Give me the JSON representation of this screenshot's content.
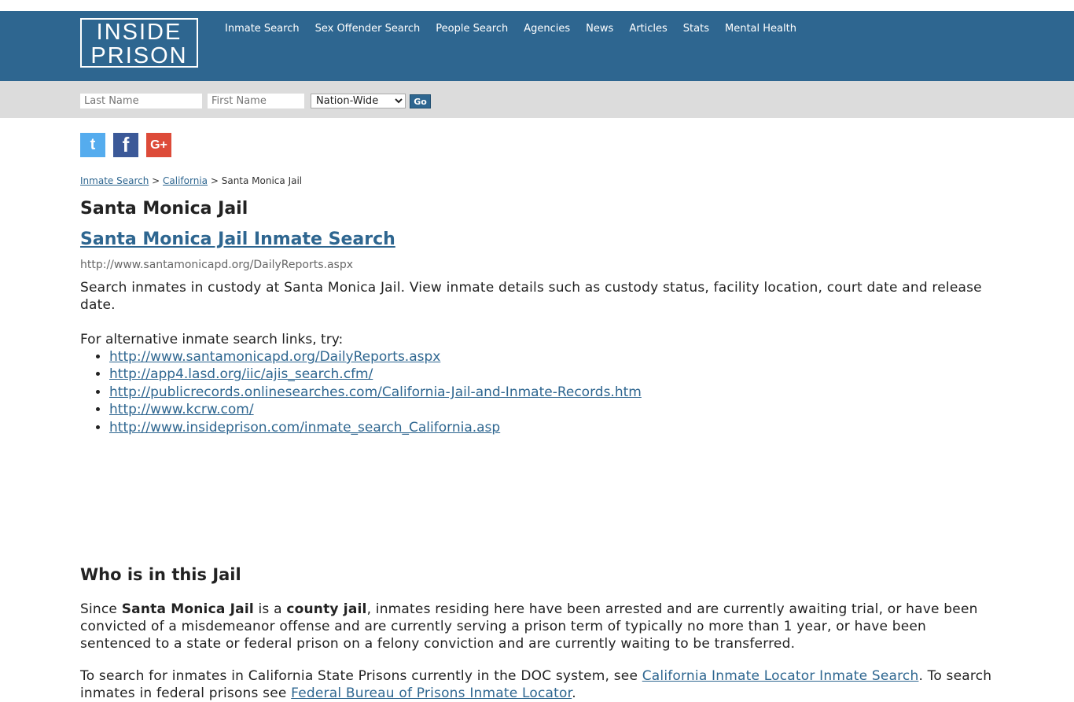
{
  "header": {
    "logo_line1": "INSIDE",
    "logo_line2": "PRISON",
    "nav": [
      "Inmate Search",
      "Sex Offender Search",
      "People Search",
      "Agencies",
      "News",
      "Articles",
      "Stats",
      "Mental Health"
    ]
  },
  "search": {
    "last_name_placeholder": "Last Name",
    "first_name_placeholder": "First Name",
    "scope_selected": "Nation-Wide",
    "go_label": "Go"
  },
  "social": {
    "twitter": "t",
    "facebook": "f",
    "google": "G+"
  },
  "breadcrumb": {
    "root": "Inmate Search",
    "state": "California",
    "current": "Santa Monica Jail",
    "sep": ">"
  },
  "page": {
    "title": "Santa Monica Jail",
    "search_link": "Santa Monica Jail Inmate Search",
    "source_url": "http://www.santamonicapd.org/DailyReports.aspx",
    "description": "Search inmates in custody at Santa Monica Jail. View inmate details such as custody status, facility location, court date and release date.",
    "alt_intro": "For alternative inmate search links, try:",
    "alt_links": [
      "http://www.santamonicapd.org/DailyReports.aspx",
      "http://app4.lasd.org/iic/ajis_search.cfm/",
      "http://publicrecords.onlinesearches.com/California-Jail-and-Inmate-Records.htm",
      "http://www.kcrw.com/",
      "http://www.insideprison.com/inmate_search_California.asp"
    ],
    "who_heading": "Who is in this Jail",
    "who_pre": "Since ",
    "who_name": "Santa Monica Jail",
    "who_mid": " is a ",
    "who_type": "county jail",
    "who_rest": ", inmates residing here have been arrested and are currently awaiting trial, or have been convicted of a misdemeanor offense and are currently serving a prison term of typically no more than 1 year, or have been sentenced to a state or federal prison on a felony conviction and are currently waiting to be transferred.",
    "find_text1": "To search for inmates in California State Prisons currently in the DOC system, see ",
    "find_link1": "California Inmate Locator Inmate Search",
    "find_text2": ". To search inmates in federal prisons see ",
    "find_link2": "Federal Bureau of Prisons Inmate Locator",
    "find_text3": "."
  }
}
